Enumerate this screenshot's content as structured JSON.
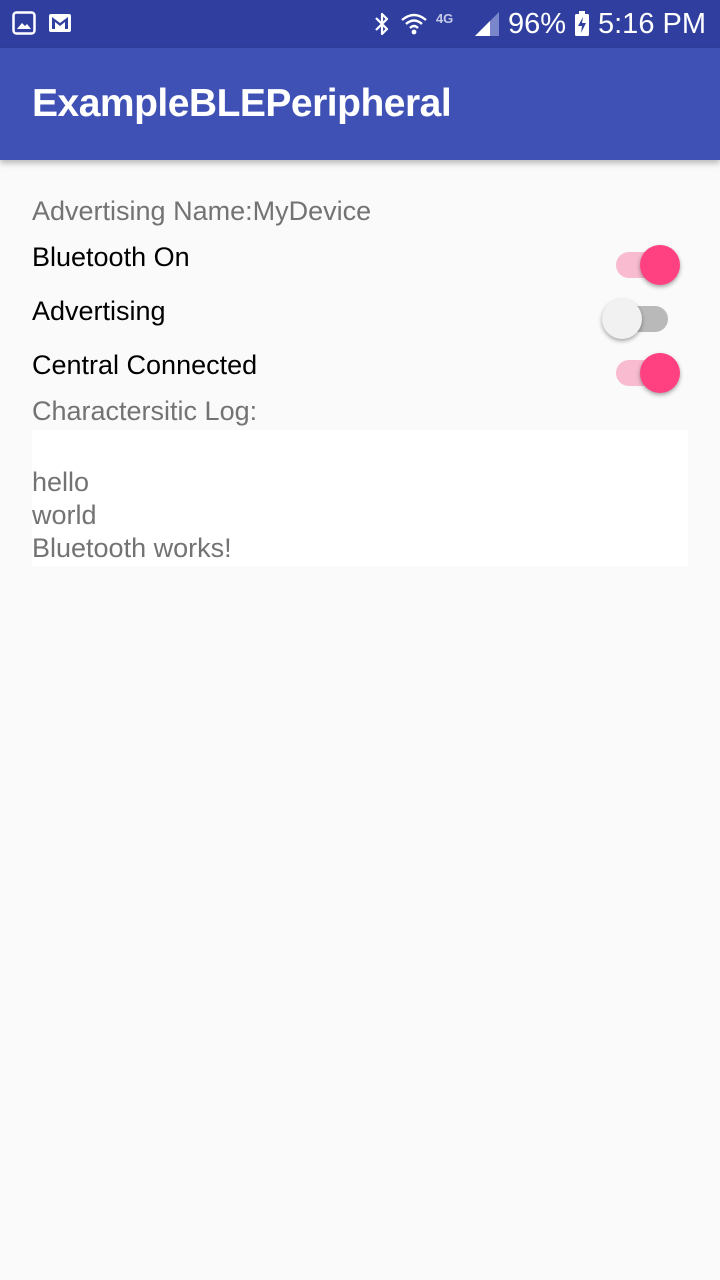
{
  "status_bar": {
    "left_icons": [
      "image-icon",
      "gmail-icon"
    ],
    "right_icons": [
      "bluetooth-icon",
      "wifi-icon",
      "network-4g-icon",
      "signal-icon",
      "battery-charging-icon"
    ],
    "network_label": "4G",
    "battery": "96%",
    "time": "5:16 PM"
  },
  "app_bar": {
    "title": "ExampleBLEPeripheral"
  },
  "main": {
    "advertising_name": "Advertising Name:MyDevice",
    "toggles": [
      {
        "label": "Bluetooth On",
        "checked": true
      },
      {
        "label": "Advertising",
        "checked": false
      },
      {
        "label": "Central Connected",
        "checked": true
      }
    ],
    "log_label": "Charactersitic Log:",
    "log_lines": [
      "hello",
      "world",
      "Bluetooth works!"
    ]
  },
  "colors": {
    "status_bar": "#303f9f",
    "app_bar": "#3f51b5",
    "accent": "#ff4081",
    "accent_track": "#f8bbd0",
    "off_track": "#b9b9b9",
    "off_thumb": "#f1f1f1",
    "background": "#fafafa"
  }
}
